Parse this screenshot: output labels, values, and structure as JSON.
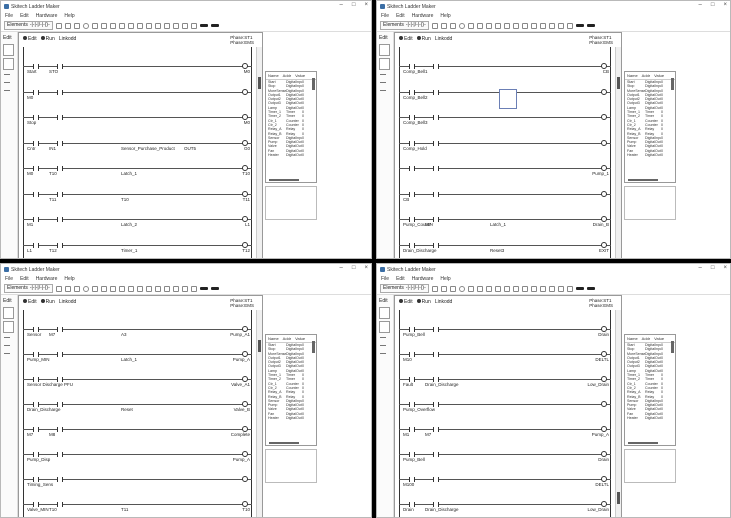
{
  "windows": [
    {
      "title": "Skitech Ladder Maker",
      "menu": [
        "File",
        "Edit",
        "Hardware",
        "Help"
      ],
      "toolbar": {
        "elements_label": "Elements",
        "combo_value": "-|-|-|/-|-()-"
      },
      "leftstrip": {
        "edit_label": "Edit"
      },
      "editor": {
        "mode_edit": "Edit",
        "mode_run": "Run",
        "extra_label": "Linkodd",
        "phase_line1": "Phase:ST1",
        "phase_line2": "Phase:EMS"
      },
      "rungs": [
        {
          "label": "Start",
          "label2": "STO",
          "right": "M0"
        },
        {
          "label": "M0",
          "label2": "",
          "right": ""
        },
        {
          "label": "Stop",
          "label2": "",
          "right": "M0"
        },
        {
          "label": "Cntr",
          "label2": "IN1",
          "right": "G0",
          "mid": "Sensor_Purchase_Product",
          "mid2": "OUT5"
        },
        {
          "label": "M0",
          "label2": "T10",
          "right": "T10",
          "mid": "Latch_1"
        },
        {
          "label": "",
          "label2": "T11",
          "right": "T11",
          "mid": "T10"
        },
        {
          "label": "M1",
          "label2": "",
          "right": "L1",
          "mid": "Latch_2"
        },
        {
          "label": "L1",
          "label2": "T12",
          "right": "T12",
          "mid": "Timer_1"
        }
      ],
      "io": {
        "headers": [
          "Name",
          "Addr",
          "Value"
        ],
        "rows": [
          [
            "Start",
            "DigitalInput",
            "0"
          ],
          [
            "Stop",
            "DigitalInput",
            "0"
          ],
          [
            "MoreSense",
            "DigitalInput",
            "0"
          ],
          [
            "Output1",
            "DigitalOut",
            "0"
          ],
          [
            "Output2",
            "DigitalOut",
            "0"
          ],
          [
            "Output3",
            "DigitalOut",
            "0"
          ],
          [
            "Lamp",
            "DigitalOut",
            "0"
          ],
          [
            "Timer_1",
            "Timer",
            "0"
          ],
          [
            "Timer_2",
            "Timer",
            "0"
          ],
          [
            "Ctr_1",
            "Counter",
            "0"
          ],
          [
            "Ctr_2",
            "Counter",
            "0"
          ],
          [
            "Relay_A",
            "Relay",
            "0"
          ],
          [
            "Relay_B",
            "Relay",
            "0"
          ],
          [
            "Sensor",
            "DigitalInput",
            "0"
          ],
          [
            "Pump",
            "DigitalOut",
            "0"
          ],
          [
            "Valve",
            "DigitalOut",
            "0"
          ],
          [
            "Fan",
            "DigitalOut",
            "0"
          ],
          [
            "Heater",
            "DigitalOut",
            "0"
          ]
        ]
      }
    },
    {
      "title": "Skitech Ladder Maker",
      "menu": [
        "File",
        "Edit",
        "Hardware",
        "Help"
      ],
      "toolbar": {
        "elements_label": "Elements",
        "combo_value": "-|-|-|/-|-()-"
      },
      "leftstrip": {
        "edit_label": "Edit"
      },
      "editor": {
        "mode_edit": "Edit",
        "mode_run": "Run",
        "extra_label": "Linkodd",
        "phase_line1": "Phase:ST1",
        "phase_line2": "Phase:EMS"
      },
      "rungs": [
        {
          "label": "Comp_Bell1",
          "label2": "",
          "right": "CB"
        },
        {
          "label": "Comp_Bell2",
          "label2": "",
          "right": ""
        },
        {
          "label": "Comp_Bell3",
          "label2": "",
          "right": ""
        },
        {
          "label": "Comp_Hold",
          "label2": "",
          "right": ""
        },
        {
          "label": "",
          "label2": "",
          "right": "Pump_1"
        },
        {
          "label": "CB",
          "label2": "",
          "right": ""
        },
        {
          "label": "Pump_Counter",
          "label2": "M7",
          "right": "Drain_B",
          "mid": "Latch_1"
        },
        {
          "label": "Drain_Discharge",
          "label2": "",
          "right": "EXIT",
          "mid": "Reset3"
        }
      ],
      "io": {
        "headers": [
          "Name",
          "Addr",
          "Value"
        ],
        "rows": [
          [
            "Start",
            "DigitalInput",
            "0"
          ],
          [
            "Stop",
            "DigitalInput",
            "0"
          ],
          [
            "MoreSense",
            "DigitalInput",
            "0"
          ],
          [
            "Output1",
            "DigitalOut",
            "0"
          ],
          [
            "Output2",
            "DigitalOut",
            "0"
          ],
          [
            "Output3",
            "DigitalOut",
            "0"
          ],
          [
            "Lamp",
            "DigitalOut",
            "0"
          ],
          [
            "Timer_1",
            "Timer",
            "0"
          ],
          [
            "Timer_2",
            "Timer",
            "0"
          ],
          [
            "Ctr_1",
            "Counter",
            "0"
          ],
          [
            "Ctr_2",
            "Counter",
            "0"
          ],
          [
            "Relay_A",
            "Relay",
            "0"
          ],
          [
            "Relay_B",
            "Relay",
            "0"
          ],
          [
            "Sensor",
            "DigitalInput",
            "0"
          ],
          [
            "Pump",
            "DigitalOut",
            "0"
          ],
          [
            "Valve",
            "DigitalOut",
            "0"
          ],
          [
            "Fan",
            "DigitalOut",
            "0"
          ],
          [
            "Heater",
            "DigitalOut",
            "0"
          ]
        ]
      }
    },
    {
      "title": "Skitech Ladder Maker",
      "menu": [
        "File",
        "Edit",
        "Hardware",
        "Help"
      ],
      "toolbar": {
        "elements_label": "Elements",
        "combo_value": "-|-|-|/-|-()-"
      },
      "leftstrip": {
        "edit_label": "Edit"
      },
      "editor": {
        "mode_edit": "Edit",
        "mode_run": "Run",
        "extra_label": "Linkodd",
        "phase_line1": "Phase:ST1",
        "phase_line2": "Phase:EMS"
      },
      "rungs": [
        {
          "label": "Sensor",
          "label2": "M7",
          "right": "Pump_A1",
          "mid": "A3"
        },
        {
          "label": "Pump_MIN",
          "label2": "",
          "right": "Pump_A",
          "mid": "Latch_1"
        },
        {
          "label": "Sensor Discharge PFU",
          "label2": "",
          "right": "Valve_A1"
        },
        {
          "label": "Drain_Discharge",
          "label2": "",
          "right": "Valve_B",
          "mid": "Reset"
        },
        {
          "label": "M7",
          "label2": "M8",
          "right": "Complete"
        },
        {
          "label": "Pump_Disp",
          "label2": "",
          "right": "Pump_A"
        },
        {
          "label": "Timing_Sens",
          "label2": "",
          "right": ""
        },
        {
          "label": "Valve_MIN",
          "label2": "T10",
          "right": "T10",
          "mid": "T11"
        }
      ],
      "io": {
        "headers": [
          "Name",
          "Addr",
          "Value"
        ],
        "rows": [
          [
            "Start",
            "DigitalInput",
            "0"
          ],
          [
            "Stop",
            "DigitalInput",
            "0"
          ],
          [
            "MoreSense",
            "DigitalInput",
            "0"
          ],
          [
            "Output1",
            "DigitalOut",
            "0"
          ],
          [
            "Output2",
            "DigitalOut",
            "0"
          ],
          [
            "Output3",
            "DigitalOut",
            "0"
          ],
          [
            "Lamp",
            "DigitalOut",
            "0"
          ],
          [
            "Timer_1",
            "Timer",
            "0"
          ],
          [
            "Timer_2",
            "Timer",
            "0"
          ],
          [
            "Ctr_1",
            "Counter",
            "0"
          ],
          [
            "Ctr_2",
            "Counter",
            "0"
          ],
          [
            "Relay_A",
            "Relay",
            "0"
          ],
          [
            "Relay_B",
            "Relay",
            "0"
          ],
          [
            "Sensor",
            "DigitalInput",
            "0"
          ],
          [
            "Pump",
            "DigitalOut",
            "0"
          ],
          [
            "Valve",
            "DigitalOut",
            "0"
          ],
          [
            "Fan",
            "DigitalOut",
            "0"
          ],
          [
            "Heater",
            "DigitalOut",
            "0"
          ]
        ]
      }
    },
    {
      "title": "Skitech Ladder Maker",
      "menu": [
        "File",
        "Edit",
        "Hardware",
        "Help"
      ],
      "toolbar": {
        "elements_label": "Elements",
        "combo_value": "-|-|-|/-|-()-"
      },
      "leftstrip": {
        "edit_label": "Edit"
      },
      "editor": {
        "mode_edit": "Edit",
        "mode_run": "Run",
        "extra_label": "Linkodd",
        "phase_line1": "Phase:ST1",
        "phase_line2": "Phase:EMS"
      },
      "rungs": [
        {
          "label": "Pump_Bell",
          "label2": "",
          "right": "Drain"
        },
        {
          "label": "M10",
          "label2": "",
          "right": "DELTL"
        },
        {
          "label": "Fault",
          "label2": "Drain_Discharge",
          "right": "Low_Drain"
        },
        {
          "label": "Pump_Overflow",
          "label2": "",
          "right": ""
        },
        {
          "label": "M1",
          "label2": "M7",
          "right": "Pump_A"
        },
        {
          "label": "Pump_Bell",
          "label2": "",
          "right": "Drain"
        },
        {
          "label": "M100",
          "label2": "",
          "right": "DELTL"
        },
        {
          "label": "Drain",
          "label2": "Drain_Discharge",
          "right": "Low_Drain"
        }
      ],
      "io": {
        "headers": [
          "Name",
          "Addr",
          "Value"
        ],
        "rows": [
          [
            "Start",
            "DigitalInput",
            "0"
          ],
          [
            "Stop",
            "DigitalInput",
            "0"
          ],
          [
            "MoreSense",
            "DigitalInput",
            "0"
          ],
          [
            "Output1",
            "DigitalOut",
            "0"
          ],
          [
            "Output2",
            "DigitalOut",
            "0"
          ],
          [
            "Output3",
            "DigitalOut",
            "0"
          ],
          [
            "Lamp",
            "DigitalOut",
            "0"
          ],
          [
            "Timer_1",
            "Timer",
            "0"
          ],
          [
            "Timer_2",
            "Timer",
            "0"
          ],
          [
            "Ctr_1",
            "Counter",
            "0"
          ],
          [
            "Ctr_2",
            "Counter",
            "0"
          ],
          [
            "Relay_A",
            "Relay",
            "0"
          ],
          [
            "Relay_B",
            "Relay",
            "0"
          ],
          [
            "Sensor",
            "DigitalInput",
            "0"
          ],
          [
            "Pump",
            "DigitalOut",
            "0"
          ],
          [
            "Valve",
            "DigitalOut",
            "0"
          ],
          [
            "Fan",
            "DigitalOut",
            "0"
          ],
          [
            "Heater",
            "DigitalOut",
            "0"
          ]
        ]
      }
    }
  ]
}
